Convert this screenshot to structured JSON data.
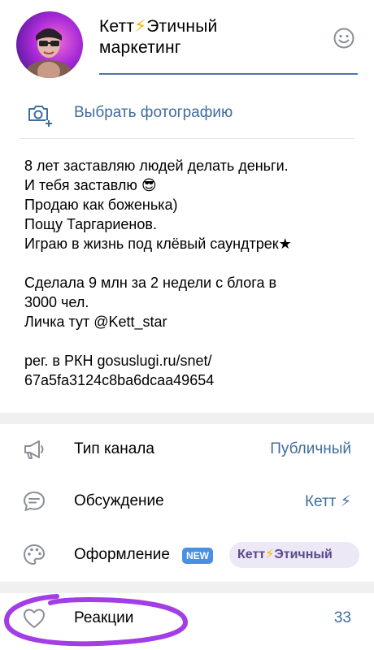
{
  "channel": {
    "title_line1_prefix": "Кетт",
    "title_bolt": "⚡",
    "title_line1_suffix": "Этичный",
    "title_line2": "маркетинг"
  },
  "photo": {
    "label": "Выбрать фотографию"
  },
  "description": {
    "lines": [
      "8 лет заставляю людей делать деньги.",
      "И тебя заставлю 😎",
      "Продаю как боженька)",
      "Пощу Таргариенов.",
      "Играю в жизнь под клёвый саундтрек★",
      "",
      "Сделала 9 млн за 2 недели с блога в",
      "3000 чел.",
      "Личка тут @Kett_star",
      "",
      "рег. в РКН gosuslugi.ru/snet/",
      "67a5fa3124c8ba6dcaa49654"
    ]
  },
  "settings": {
    "channel_type": {
      "label": "Тип канала",
      "value": "Публичный"
    },
    "discussion": {
      "label": "Обсуждение",
      "value": "Кетт ⚡"
    },
    "appearance": {
      "label": "Оформление",
      "badge": "NEW",
      "value_prefix": "Кетт",
      "value_bolt": "⚡",
      "value_suffix": "Этичный"
    },
    "reactions": {
      "label": "Реакции",
      "value": "33"
    }
  },
  "colors": {
    "accent": "#3f6d9d",
    "badge": "#4a90e2",
    "highlight_circle": "#a33de6",
    "bolt": "#f5b300"
  }
}
